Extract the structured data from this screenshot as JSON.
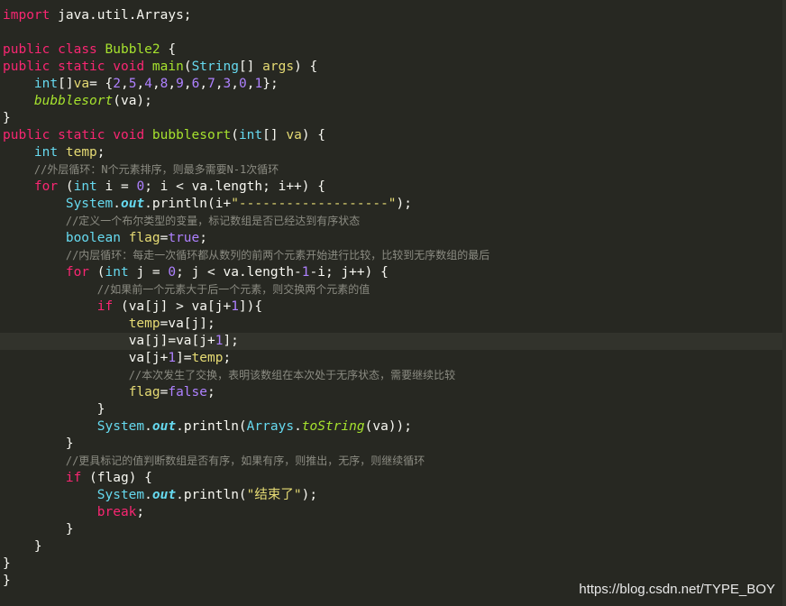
{
  "colors": {
    "background": "#272822",
    "keyword": "#f92672",
    "type": "#66d9ef",
    "class": "#a6e22e",
    "string": "#e6db74",
    "number": "#ae81ff",
    "comment": "#8b8b82",
    "text": "#f8f8f2",
    "active_line": "#32332c"
  },
  "active_line_index": 19,
  "code_lines": [
    {
      "indent": "",
      "tokens": [
        [
          "kw",
          "import"
        ],
        [
          "var",
          " java.util.Arrays;"
        ]
      ]
    },
    {
      "indent": "",
      "tokens": []
    },
    {
      "indent": "",
      "tokens": [
        [
          "kw",
          "public"
        ],
        [
          "var",
          " "
        ],
        [
          "kw",
          "class"
        ],
        [
          "var",
          " "
        ],
        [
          "cls",
          "Bubble2"
        ],
        [
          "var",
          " {"
        ]
      ]
    },
    {
      "indent": "",
      "tokens": [
        [
          "kw",
          "public"
        ],
        [
          "var",
          " "
        ],
        [
          "kw",
          "static"
        ],
        [
          "var",
          " "
        ],
        [
          "kw",
          "void"
        ],
        [
          "var",
          " "
        ],
        [
          "cls",
          "main"
        ],
        [
          "var",
          "("
        ],
        [
          "type",
          "String"
        ],
        [
          "var",
          "[] "
        ],
        [
          "fn",
          "args"
        ],
        [
          "var",
          ") {"
        ]
      ]
    },
    {
      "indent": "    ",
      "tokens": [
        [
          "type",
          "int"
        ],
        [
          "var",
          "[]"
        ],
        [
          "fn",
          "va"
        ],
        [
          "var",
          "= {"
        ],
        [
          "num",
          "2"
        ],
        [
          "var",
          ","
        ],
        [
          "num",
          "5"
        ],
        [
          "var",
          ","
        ],
        [
          "num",
          "4"
        ],
        [
          "var",
          ","
        ],
        [
          "num",
          "8"
        ],
        [
          "var",
          ","
        ],
        [
          "num",
          "9"
        ],
        [
          "var",
          ","
        ],
        [
          "num",
          "6"
        ],
        [
          "var",
          ","
        ],
        [
          "num",
          "7"
        ],
        [
          "var",
          ","
        ],
        [
          "num",
          "3"
        ],
        [
          "var",
          ","
        ],
        [
          "num",
          "0"
        ],
        [
          "var",
          ","
        ],
        [
          "num",
          "1"
        ],
        [
          "var",
          "};"
        ]
      ]
    },
    {
      "indent": "    ",
      "tokens": [
        [
          "cls ital",
          "bubblesort"
        ],
        [
          "var",
          "(va);"
        ]
      ]
    },
    {
      "indent": "",
      "tokens": [
        [
          "var",
          "}"
        ]
      ]
    },
    {
      "indent": "",
      "tokens": [
        [
          "kw",
          "public"
        ],
        [
          "var",
          " "
        ],
        [
          "kw",
          "static"
        ],
        [
          "var",
          " "
        ],
        [
          "kw",
          "void"
        ],
        [
          "var",
          " "
        ],
        [
          "cls",
          "bubblesort"
        ],
        [
          "var",
          "("
        ],
        [
          "type",
          "int"
        ],
        [
          "var",
          "[] "
        ],
        [
          "fn",
          "va"
        ],
        [
          "var",
          ") {"
        ]
      ]
    },
    {
      "indent": "    ",
      "tokens": [
        [
          "type",
          "int"
        ],
        [
          "var",
          " "
        ],
        [
          "fn",
          "temp"
        ],
        [
          "var",
          ";"
        ]
      ]
    },
    {
      "indent": "    ",
      "tokens": [
        [
          "cmt",
          "//外层循环：N个元素排序，则最多需要N-1次循环"
        ]
      ]
    },
    {
      "indent": "    ",
      "tokens": [
        [
          "kw",
          "for"
        ],
        [
          "var",
          " ("
        ],
        [
          "type",
          "int"
        ],
        [
          "var",
          " i = "
        ],
        [
          "num",
          "0"
        ],
        [
          "var",
          "; i < va.length; i++) {"
        ]
      ]
    },
    {
      "indent": "        ",
      "tokens": [
        [
          "type",
          "System"
        ],
        [
          "var",
          "."
        ],
        [
          "type bold ital",
          "out"
        ],
        [
          "var",
          ".println(i+"
        ],
        [
          "str",
          "\"-------------------\""
        ],
        [
          "var",
          ");"
        ]
      ]
    },
    {
      "indent": "        ",
      "tokens": [
        [
          "cmt",
          "//定义一个布尔类型的变量，标记数组是否已经达到有序状态"
        ]
      ]
    },
    {
      "indent": "        ",
      "tokens": [
        [
          "type",
          "boolean"
        ],
        [
          "var",
          " "
        ],
        [
          "fn",
          "flag"
        ],
        [
          "var",
          "="
        ],
        [
          "num",
          "true"
        ],
        [
          "var",
          ";"
        ]
      ]
    },
    {
      "indent": "        ",
      "tokens": [
        [
          "cmt",
          "//内层循环：每走一次循环都从数列的前两个元素开始进行比较，比较到无序数组的最后"
        ]
      ]
    },
    {
      "indent": "        ",
      "tokens": [
        [
          "kw",
          "for"
        ],
        [
          "var",
          " ("
        ],
        [
          "type",
          "int"
        ],
        [
          "var",
          " j = "
        ],
        [
          "num",
          "0"
        ],
        [
          "var",
          "; j < va.length-"
        ],
        [
          "num",
          "1"
        ],
        [
          "var",
          "-i; j++) {"
        ]
      ]
    },
    {
      "indent": "            ",
      "tokens": [
        [
          "cmt",
          "//如果前一个元素大于后一个元素，则交换两个元素的值"
        ]
      ]
    },
    {
      "indent": "            ",
      "tokens": [
        [
          "kw",
          "if"
        ],
        [
          "var",
          " (va[j] > va[j+"
        ],
        [
          "num",
          "1"
        ],
        [
          "var",
          "]){"
        ]
      ]
    },
    {
      "indent": "                ",
      "tokens": [
        [
          "fn",
          "temp"
        ],
        [
          "var",
          "=va[j];"
        ]
      ]
    },
    {
      "indent": "                ",
      "tokens": [
        [
          "var",
          "va[j]=va[j+"
        ],
        [
          "num",
          "1"
        ],
        [
          "var",
          "];"
        ]
      ]
    },
    {
      "indent": "                ",
      "tokens": [
        [
          "var",
          "va[j+"
        ],
        [
          "num",
          "1"
        ],
        [
          "var",
          "]="
        ],
        [
          "fn",
          "temp"
        ],
        [
          "var",
          ";"
        ]
      ]
    },
    {
      "indent": "                ",
      "tokens": [
        [
          "cmt",
          "//本次发生了交换，表明该数组在本次处于无序状态，需要继续比较"
        ]
      ]
    },
    {
      "indent": "                ",
      "tokens": [
        [
          "fn",
          "flag"
        ],
        [
          "var",
          "="
        ],
        [
          "num",
          "false"
        ],
        [
          "var",
          ";"
        ]
      ]
    },
    {
      "indent": "            ",
      "tokens": [
        [
          "var",
          "}"
        ]
      ]
    },
    {
      "indent": "            ",
      "tokens": [
        [
          "type",
          "System"
        ],
        [
          "var",
          "."
        ],
        [
          "type bold ital",
          "out"
        ],
        [
          "var",
          ".println("
        ],
        [
          "type",
          "Arrays"
        ],
        [
          "var",
          "."
        ],
        [
          "cls ital",
          "toString"
        ],
        [
          "var",
          "(va));"
        ]
      ]
    },
    {
      "indent": "        ",
      "tokens": [
        [
          "var",
          "}"
        ]
      ]
    },
    {
      "indent": "        ",
      "tokens": [
        [
          "cmt",
          "//更具标记的值判断数组是否有序，如果有序，则推出，无序，则继续循环"
        ]
      ]
    },
    {
      "indent": "        ",
      "tokens": [
        [
          "kw",
          "if"
        ],
        [
          "var",
          " (flag) {"
        ]
      ]
    },
    {
      "indent": "            ",
      "tokens": [
        [
          "type",
          "System"
        ],
        [
          "var",
          "."
        ],
        [
          "type bold ital",
          "out"
        ],
        [
          "var",
          ".println("
        ],
        [
          "str",
          "\"结束了\""
        ],
        [
          "var",
          ");"
        ]
      ]
    },
    {
      "indent": "            ",
      "tokens": [
        [
          "kw",
          "break"
        ],
        [
          "var",
          ";"
        ]
      ]
    },
    {
      "indent": "        ",
      "tokens": [
        [
          "var",
          "}"
        ]
      ]
    },
    {
      "indent": "    ",
      "tokens": [
        [
          "var",
          "}"
        ]
      ]
    },
    {
      "indent": "",
      "tokens": [
        [
          "var",
          "}"
        ]
      ]
    },
    {
      "indent": "",
      "tokens": [
        [
          "var",
          "}"
        ]
      ]
    }
  ],
  "watermark": "https://blog.csdn.net/TYPE_BOY"
}
